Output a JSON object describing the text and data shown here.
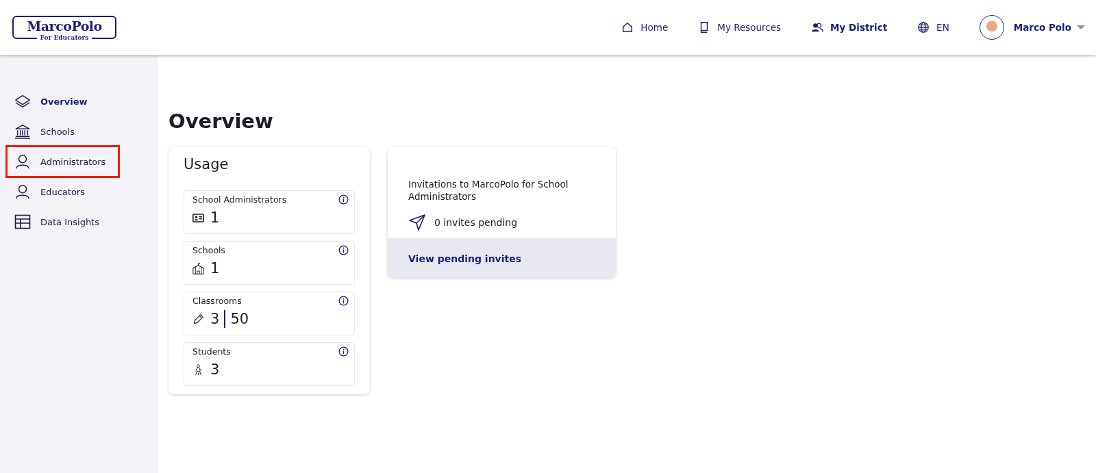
{
  "header": {
    "logo": {
      "name": "MarcoPolo",
      "tagline": "For Educators"
    },
    "nav": [
      {
        "kind": "home",
        "label": "Home",
        "selected": false
      },
      {
        "kind": "book",
        "label": "My Resources",
        "selected": false
      },
      {
        "kind": "people",
        "label": "My District",
        "selected": true
      },
      {
        "kind": "globe",
        "label": "EN",
        "selected": false
      }
    ],
    "user": {
      "name": "Marco Polo"
    }
  },
  "sidebar": {
    "items": [
      {
        "kind": "layers",
        "label": "Overview",
        "selected": true,
        "highlighted": false
      },
      {
        "kind": "bank",
        "label": "Schools",
        "selected": false,
        "highlighted": false
      },
      {
        "kind": "person",
        "label": "Administrators",
        "selected": false,
        "highlighted": true
      },
      {
        "kind": "person",
        "label": "Educators",
        "selected": false,
        "highlighted": false
      },
      {
        "kind": "table",
        "label": "Data Insights",
        "selected": false,
        "highlighted": false
      }
    ]
  },
  "page_title": "Overview",
  "usage": {
    "title": "Usage",
    "stats": [
      {
        "kind": "id-card",
        "label": "School Administrators",
        "values": [
          "1"
        ]
      },
      {
        "kind": "school",
        "label": "Schools",
        "values": [
          "1"
        ]
      },
      {
        "kind": "pencil",
        "label": "Classrooms",
        "values": [
          "3",
          "50"
        ]
      },
      {
        "kind": "child",
        "label": "Students",
        "values": [
          "3"
        ]
      }
    ]
  },
  "invitations": {
    "text": "Invitations to MarcoPolo for School Administrators",
    "pending": "0 invites pending",
    "link": "View pending invites"
  }
}
